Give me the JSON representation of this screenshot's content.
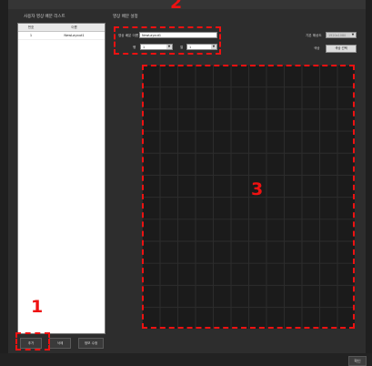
{
  "left_panel": {
    "title": "사용자 영상 배분 리스트"
  },
  "list": {
    "headers": [
      "번호",
      "이름"
    ],
    "rows": [
      {
        "num": "1",
        "name": "NewLayout1"
      }
    ]
  },
  "buttons": {
    "add": "추가",
    "delete": "삭제",
    "edit": "정보 수정",
    "ok": "확인"
  },
  "right_panel": {
    "title": "영상 배분 설정"
  },
  "form": {
    "name_label": "영상 배분 이름",
    "name_value": "NewLayout1",
    "row_label": "행",
    "row_value": "1",
    "col_label": "열",
    "col_value": "1",
    "monitor_label": "기본 해상도",
    "monitor_value": "1920x1080",
    "color_label": "색상",
    "color_button": "색상 선택"
  },
  "callouts": {
    "c1": "1",
    "c2": "2",
    "c3": "3"
  },
  "colors": {
    "callout": "#ee1111",
    "canvas": "#1b1b1b"
  }
}
